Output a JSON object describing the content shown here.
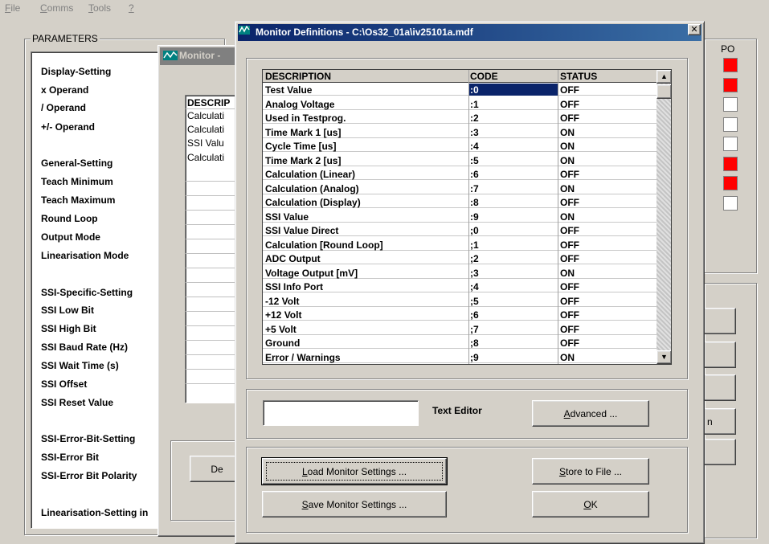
{
  "menu": {
    "items": [
      {
        "key": "F",
        "rest": "ile"
      },
      {
        "key": "C",
        "rest": "omms"
      },
      {
        "key": "T",
        "rest": "ools"
      },
      {
        "key": "?",
        "rest": ""
      }
    ]
  },
  "parameters": {
    "title": "PARAMETERS",
    "items": [
      "Display-Setting",
      "x Operand",
      "/ Operand",
      "+/- Operand",
      "General-Setting",
      "Teach Minimum",
      "Teach Maximum",
      "Round Loop",
      "Output Mode",
      "Linearisation Mode",
      "SSI-Specific-Setting",
      "SSI Low Bit",
      "SSI High Bit",
      "SSI Baud Rate (Hz)",
      "SSI Wait Time (s)",
      "SSI Offset",
      "SSI Reset Value",
      "SSI-Error-Bit-Setting",
      "SSI-Error Bit",
      "SSI-Error Bit Polarity",
      "Linearisation-Setting in"
    ]
  },
  "monitor_window": {
    "title": "Monitor -",
    "table_header": "DESCRIP",
    "cells": [
      "Calculati",
      "Calculati",
      "SSI Valu",
      "Calculati"
    ],
    "button": "De"
  },
  "right_panel": {
    "po_label": "PO",
    "indicators": [
      "#ff0000",
      "#ff0000",
      "#ffffff",
      "#ffffff",
      "#ffffff",
      "#ff0000",
      "#ff0000",
      "#ffffff"
    ],
    "partial_button": "n"
  },
  "dialog": {
    "title": "Monitor Definitions  -  C:\\Os32_01a\\iv25101a.mdf",
    "close": "✕",
    "headers": {
      "description": "DESCRIPTION",
      "code": "CODE",
      "status": "STATUS"
    },
    "rows": [
      {
        "description": "Test Value",
        "code": ":0",
        "status": "OFF"
      },
      {
        "description": "Analog Voltage",
        "code": ":1",
        "status": "OFF"
      },
      {
        "description": "Used in Testprog.",
        "code": ":2",
        "status": "OFF"
      },
      {
        "description": "Time Mark 1 [us]",
        "code": ":3",
        "status": "ON"
      },
      {
        "description": "Cycle Time [us]",
        "code": ":4",
        "status": "ON"
      },
      {
        "description": "Time Mark 2 [us]",
        "code": ":5",
        "status": "ON"
      },
      {
        "description": "Calculation (Linear)",
        "code": ":6",
        "status": "OFF"
      },
      {
        "description": "Calculation (Analog)",
        "code": ":7",
        "status": "ON"
      },
      {
        "description": "Calculation (Display)",
        "code": ":8",
        "status": "OFF"
      },
      {
        "description": "SSI Value",
        "code": ":9",
        "status": "ON"
      },
      {
        "description": "SSI Value Direct",
        "code": ";0",
        "status": "OFF"
      },
      {
        "description": "Calculation [Round Loop]",
        "code": ";1",
        "status": "OFF"
      },
      {
        "description": "ADC Output",
        "code": ";2",
        "status": "OFF"
      },
      {
        "description": "Voltage Output [mV]",
        "code": ";3",
        "status": "ON"
      },
      {
        "description": "SSI Info Port",
        "code": ";4",
        "status": "OFF"
      },
      {
        "description": "-12 Volt",
        "code": ";5",
        "status": "OFF"
      },
      {
        "description": "+12 Volt",
        "code": ";6",
        "status": "OFF"
      },
      {
        "description": "+5 Volt",
        "code": ";7",
        "status": "OFF"
      },
      {
        "description": "Ground",
        "code": ";8",
        "status": "OFF"
      },
      {
        "description": "Error / Warnings",
        "code": ";9",
        "status": "ON"
      }
    ],
    "text_editor_value": "",
    "text_editor_label": "Text Editor",
    "buttons": {
      "advanced": {
        "key": "A",
        "rest": "dvanced ..."
      },
      "load": {
        "key": "L",
        "rest": "oad Monitor Settings ..."
      },
      "save": {
        "key": "S",
        "rest": "ave Monitor Settings ..."
      },
      "store": {
        "key": "S",
        "rest": "tore to File ..."
      },
      "ok": {
        "key": "O",
        "rest": "K"
      }
    }
  },
  "colors": {
    "title_active": "#0a246a",
    "title_inactive": "#808080",
    "face": "#d4d0c8",
    "selection": "#0a246a"
  }
}
